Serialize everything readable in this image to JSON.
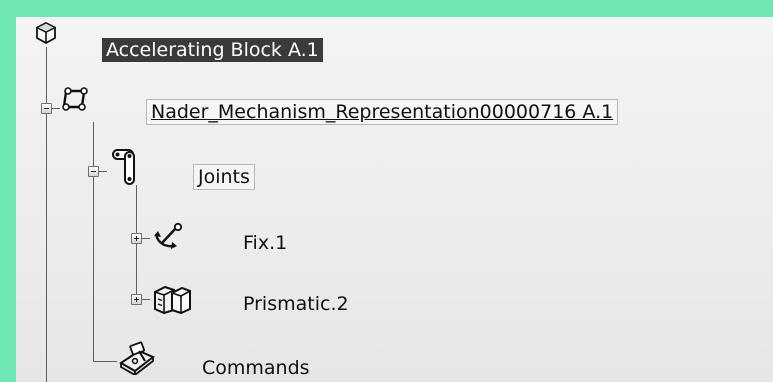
{
  "tree": {
    "root": {
      "label": "Accelerating Block A.1",
      "icon": "product-icon",
      "selected": true
    },
    "mechanism": {
      "label": "Nader_Mechanism_Representation00000716 A.1",
      "icon": "mechanism-icon",
      "expanded": true
    },
    "joints": {
      "label": "Joints",
      "icon": "joints-icon",
      "expanded": true
    },
    "fix": {
      "label": "Fix.1",
      "icon": "fixed-anchor-icon",
      "expanded": false
    },
    "prismatic": {
      "label": "Prismatic.2",
      "icon": "prismatic-joint-icon",
      "expanded": false
    },
    "commands": {
      "label": "Commands",
      "icon": "commands-icon"
    }
  },
  "colors": {
    "background": "#6fe7b3",
    "panel": "#eeeeee",
    "selection": "#3a3a3a",
    "tree_line": "#606060"
  }
}
